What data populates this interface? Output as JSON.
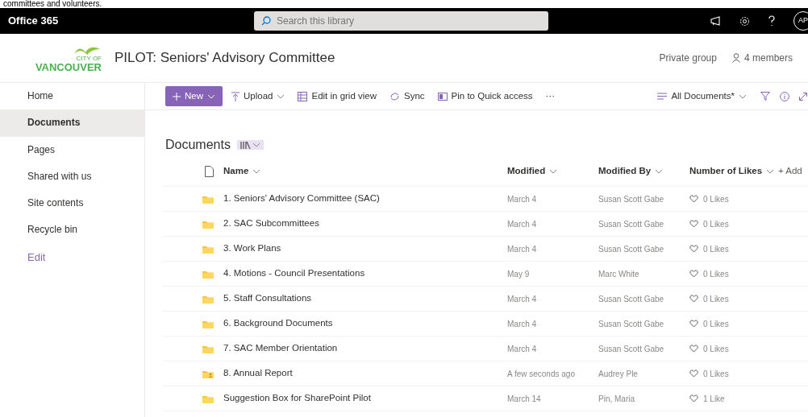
{
  "caption": "committees and volunteers.",
  "topbar": {
    "app_name": "Office 365",
    "search": {
      "placeholder": "Search this library"
    },
    "avatar": "AP"
  },
  "header": {
    "logo_top": "CITY OF",
    "logo_bottom": "VANCOUVER",
    "title": "PILOT: Seniors' Advisory Committee",
    "privacy": "Private group",
    "members": "4 members"
  },
  "sidebar": {
    "items": [
      {
        "label": "Home",
        "selected": false,
        "kind": "nav"
      },
      {
        "label": "Documents",
        "selected": true,
        "kind": "nav"
      },
      {
        "label": "Pages",
        "selected": false,
        "kind": "nav"
      },
      {
        "label": "Shared with us",
        "selected": false,
        "kind": "nav"
      },
      {
        "label": "Site contents",
        "selected": false,
        "kind": "nav"
      },
      {
        "label": "Recycle bin",
        "selected": false,
        "kind": "nav"
      },
      {
        "label": "Edit",
        "selected": false,
        "kind": "edit"
      }
    ]
  },
  "commandbar": {
    "new": "New",
    "upload": "Upload",
    "grid": "Edit in grid view",
    "sync": "Sync",
    "pin": "Pin to Quick access",
    "more": "···",
    "view": "All Documents*"
  },
  "library": {
    "title": "Documents"
  },
  "table": {
    "columns": [
      "Name",
      "Modified",
      "Modified By",
      "Number of Likes"
    ],
    "add_column": "+ Add",
    "rows": [
      {
        "kind": "folder",
        "name": "1. Seniors' Advisory Committee (SAC)",
        "modified": "March 4",
        "modified_by": "Susan Scott Gabe",
        "likes": "0 Likes"
      },
      {
        "kind": "folder",
        "name": "2. SAC Subcommittees",
        "modified": "March 4",
        "modified_by": "Susan Scott Gabe",
        "likes": "0 Likes"
      },
      {
        "kind": "folder",
        "name": "3. Work Plans",
        "modified": "March 4",
        "modified_by": "Susan Scott Gabe",
        "likes": "0 Likes"
      },
      {
        "kind": "folder",
        "name": "4. Motions - Council Presentations",
        "modified": "May 9",
        "modified_by": "Marc White",
        "likes": "0 Likes"
      },
      {
        "kind": "folder",
        "name": "5. Staff Consultations",
        "modified": "March 4",
        "modified_by": "Susan Scott Gabe",
        "likes": "0 Likes"
      },
      {
        "kind": "folder",
        "name": "6. Background Documents",
        "modified": "March 4",
        "modified_by": "Susan Scott Gabe",
        "likes": "0 Likes"
      },
      {
        "kind": "folder",
        "name": "7. SAC Member Orientation",
        "modified": "March 4",
        "modified_by": "Susan Scott Gabe",
        "likes": "0 Likes"
      },
      {
        "kind": "shared-folder",
        "name": "8. Annual Report",
        "modified": "A few seconds ago",
        "modified_by": "Audrey Ple",
        "likes": "0 Likes"
      },
      {
        "kind": "folder",
        "name": "Suggestion Box for SharePoint Pilot",
        "modified": "March 14",
        "modified_by": "Pin, Maria",
        "likes": "1 Like"
      }
    ]
  }
}
